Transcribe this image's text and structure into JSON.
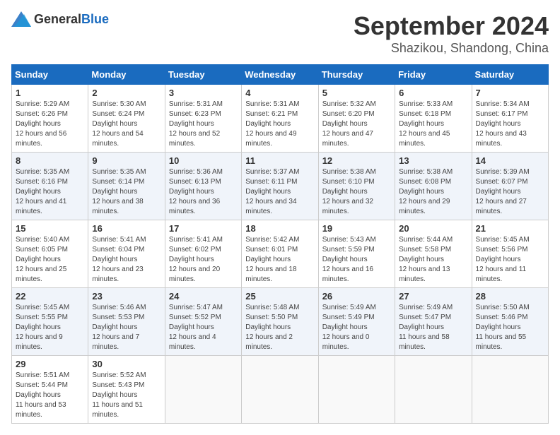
{
  "header": {
    "logo_general": "General",
    "logo_blue": "Blue",
    "month": "September 2024",
    "location": "Shazikou, Shandong, China"
  },
  "weekdays": [
    "Sunday",
    "Monday",
    "Tuesday",
    "Wednesday",
    "Thursday",
    "Friday",
    "Saturday"
  ],
  "weeks": [
    [
      {
        "day": 1,
        "sunrise": "5:29 AM",
        "sunset": "6:26 PM",
        "daylight": "12 hours and 56 minutes."
      },
      {
        "day": 2,
        "sunrise": "5:30 AM",
        "sunset": "6:24 PM",
        "daylight": "12 hours and 54 minutes."
      },
      {
        "day": 3,
        "sunrise": "5:31 AM",
        "sunset": "6:23 PM",
        "daylight": "12 hours and 52 minutes."
      },
      {
        "day": 4,
        "sunrise": "5:31 AM",
        "sunset": "6:21 PM",
        "daylight": "12 hours and 49 minutes."
      },
      {
        "day": 5,
        "sunrise": "5:32 AM",
        "sunset": "6:20 PM",
        "daylight": "12 hours and 47 minutes."
      },
      {
        "day": 6,
        "sunrise": "5:33 AM",
        "sunset": "6:18 PM",
        "daylight": "12 hours and 45 minutes."
      },
      {
        "day": 7,
        "sunrise": "5:34 AM",
        "sunset": "6:17 PM",
        "daylight": "12 hours and 43 minutes."
      }
    ],
    [
      {
        "day": 8,
        "sunrise": "5:35 AM",
        "sunset": "6:16 PM",
        "daylight": "12 hours and 41 minutes."
      },
      {
        "day": 9,
        "sunrise": "5:35 AM",
        "sunset": "6:14 PM",
        "daylight": "12 hours and 38 minutes."
      },
      {
        "day": 10,
        "sunrise": "5:36 AM",
        "sunset": "6:13 PM",
        "daylight": "12 hours and 36 minutes."
      },
      {
        "day": 11,
        "sunrise": "5:37 AM",
        "sunset": "6:11 PM",
        "daylight": "12 hours and 34 minutes."
      },
      {
        "day": 12,
        "sunrise": "5:38 AM",
        "sunset": "6:10 PM",
        "daylight": "12 hours and 32 minutes."
      },
      {
        "day": 13,
        "sunrise": "5:38 AM",
        "sunset": "6:08 PM",
        "daylight": "12 hours and 29 minutes."
      },
      {
        "day": 14,
        "sunrise": "5:39 AM",
        "sunset": "6:07 PM",
        "daylight": "12 hours and 27 minutes."
      }
    ],
    [
      {
        "day": 15,
        "sunrise": "5:40 AM",
        "sunset": "6:05 PM",
        "daylight": "12 hours and 25 minutes."
      },
      {
        "day": 16,
        "sunrise": "5:41 AM",
        "sunset": "6:04 PM",
        "daylight": "12 hours and 23 minutes."
      },
      {
        "day": 17,
        "sunrise": "5:41 AM",
        "sunset": "6:02 PM",
        "daylight": "12 hours and 20 minutes."
      },
      {
        "day": 18,
        "sunrise": "5:42 AM",
        "sunset": "6:01 PM",
        "daylight": "12 hours and 18 minutes."
      },
      {
        "day": 19,
        "sunrise": "5:43 AM",
        "sunset": "5:59 PM",
        "daylight": "12 hours and 16 minutes."
      },
      {
        "day": 20,
        "sunrise": "5:44 AM",
        "sunset": "5:58 PM",
        "daylight": "12 hours and 13 minutes."
      },
      {
        "day": 21,
        "sunrise": "5:45 AM",
        "sunset": "5:56 PM",
        "daylight": "12 hours and 11 minutes."
      }
    ],
    [
      {
        "day": 22,
        "sunrise": "5:45 AM",
        "sunset": "5:55 PM",
        "daylight": "12 hours and 9 minutes."
      },
      {
        "day": 23,
        "sunrise": "5:46 AM",
        "sunset": "5:53 PM",
        "daylight": "12 hours and 7 minutes."
      },
      {
        "day": 24,
        "sunrise": "5:47 AM",
        "sunset": "5:52 PM",
        "daylight": "12 hours and 4 minutes."
      },
      {
        "day": 25,
        "sunrise": "5:48 AM",
        "sunset": "5:50 PM",
        "daylight": "12 hours and 2 minutes."
      },
      {
        "day": 26,
        "sunrise": "5:49 AM",
        "sunset": "5:49 PM",
        "daylight": "12 hours and 0 minutes."
      },
      {
        "day": 27,
        "sunrise": "5:49 AM",
        "sunset": "5:47 PM",
        "daylight": "11 hours and 58 minutes."
      },
      {
        "day": 28,
        "sunrise": "5:50 AM",
        "sunset": "5:46 PM",
        "daylight": "11 hours and 55 minutes."
      }
    ],
    [
      {
        "day": 29,
        "sunrise": "5:51 AM",
        "sunset": "5:44 PM",
        "daylight": "11 hours and 53 minutes."
      },
      {
        "day": 30,
        "sunrise": "5:52 AM",
        "sunset": "5:43 PM",
        "daylight": "11 hours and 51 minutes."
      },
      null,
      null,
      null,
      null,
      null
    ]
  ]
}
